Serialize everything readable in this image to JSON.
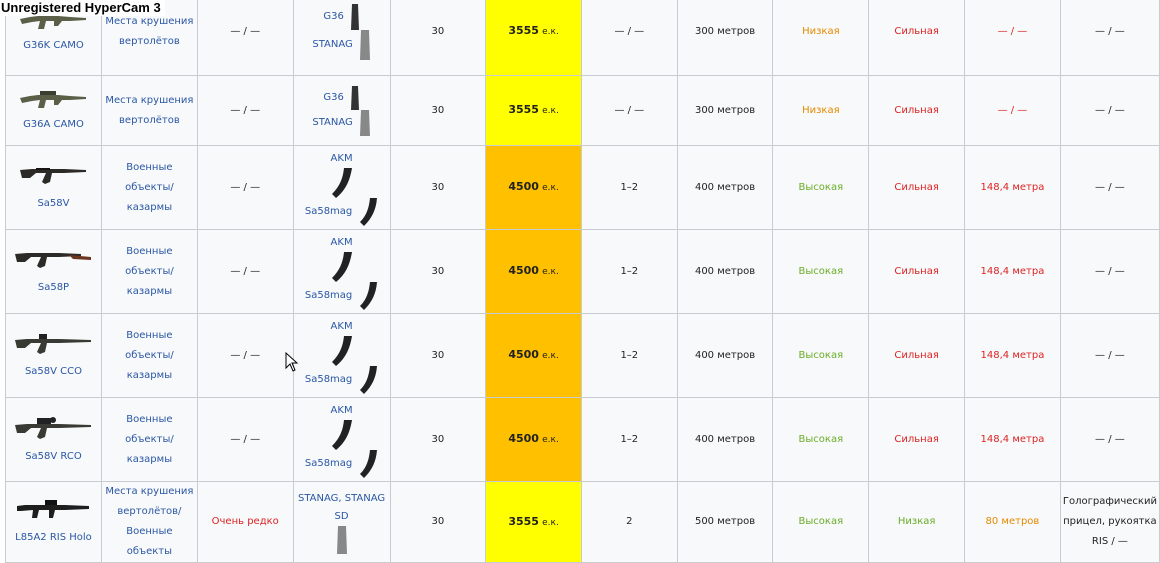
{
  "watermark": "Unregistered HyperCam 3",
  "colors": {
    "yellow": "#ffff00",
    "orange": "#ffc000",
    "link": "#2a57a5",
    "green": "#6aad29",
    "orange_text": "#e58a00",
    "red": "#dd2222"
  },
  "rows": [
    {
      "weapon": "G36K CAMO",
      "location": "Места крушения вертолётов",
      "rarity": "— / —",
      "mags": [
        "G36",
        "STANAG"
      ],
      "capacity": "30",
      "price": "3555",
      "price_unit": "е.к.",
      "col7": "— / —",
      "range": "300 метров",
      "accuracy": "Низкая",
      "recoil": "Сильная",
      "col11": "— / —",
      "attachments": "— / —"
    },
    {
      "weapon": "G36A CAMO",
      "location": "Места крушения вертолётов",
      "rarity": "— / —",
      "mags": [
        "G36",
        "STANAG"
      ],
      "capacity": "30",
      "price": "3555",
      "price_unit": "е.к.",
      "col7": "— / —",
      "range": "300 метров",
      "accuracy": "Низкая",
      "recoil": "Сильная",
      "col11": "— / —",
      "attachments": "— / —"
    },
    {
      "weapon": "Sa58V",
      "location": "Военные объекты/казармы",
      "rarity": "— / —",
      "mags": [
        "AKM",
        "Sa58mag"
      ],
      "capacity": "30",
      "price": "4500",
      "price_unit": "е.к.",
      "col7": "1–2",
      "range": "400 метров",
      "accuracy": "Высокая",
      "recoil": "Сильная",
      "col11": "148,4 метра",
      "attachments": "— / —"
    },
    {
      "weapon": "Sa58P",
      "location": "Военные объекты/казармы",
      "rarity": "— / —",
      "mags": [
        "AKM",
        "Sa58mag"
      ],
      "capacity": "30",
      "price": "4500",
      "price_unit": "е.к.",
      "col7": "1–2",
      "range": "400 метров",
      "accuracy": "Высокая",
      "recoil": "Сильная",
      "col11": "148,4 метра",
      "attachments": "— / —"
    },
    {
      "weapon": "Sa58V CCO",
      "location": "Военные объекты/казармы",
      "rarity": "— / —",
      "mags": [
        "AKM",
        "Sa58mag"
      ],
      "capacity": "30",
      "price": "4500",
      "price_unit": "е.к.",
      "col7": "1–2",
      "range": "400 метров",
      "accuracy": "Высокая",
      "recoil": "Сильная",
      "col11": "148,4 метра",
      "attachments": "— / —"
    },
    {
      "weapon": "Sa58V RCO",
      "location": "Военные объекты/казармы",
      "rarity": "— / —",
      "mags": [
        "AKM",
        "Sa58mag"
      ],
      "capacity": "30",
      "price": "4500",
      "price_unit": "е.к.",
      "col7": "1–2",
      "range": "400 метров",
      "accuracy": "Высокая",
      "recoil": "Сильная",
      "col11": "148,4 метра",
      "attachments": "— / —"
    },
    {
      "weapon": "L85A2 RIS Holo",
      "location": "Места крушения вертолётов/Военные объекты",
      "rarity": "Очень редко",
      "mags": [
        "STANAG, STANAG SD"
      ],
      "capacity": "30",
      "price": "3555",
      "price_unit": "е.к.",
      "col7": "2",
      "range": "500 метров",
      "accuracy": "Высокая",
      "recoil": "Низкая",
      "col11": "80 метров",
      "attachments": "Голографический прицел, рукоятка RIS / —"
    }
  ]
}
